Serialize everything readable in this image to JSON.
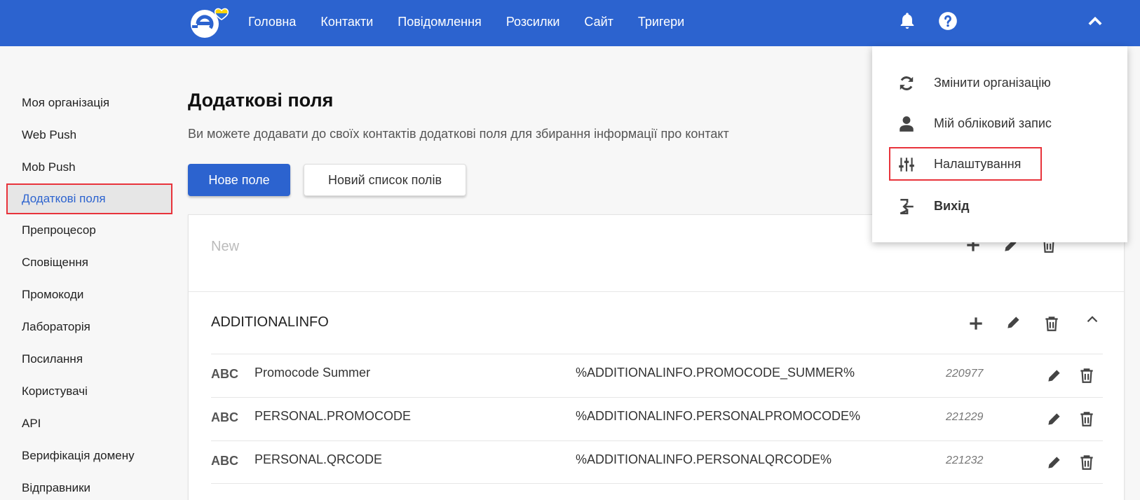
{
  "nav": {
    "items": [
      "Головна",
      "Контакти",
      "Повідомлення",
      "Розсилки",
      "Сайт",
      "Тригери"
    ]
  },
  "sidebar": {
    "items": [
      "Моя організація",
      "Web Push",
      "Mob Push",
      "Додаткові поля",
      "Препроцесор",
      "Сповіщення",
      "Промокоди",
      "Лабораторія",
      "Посилання",
      "Користувачі",
      "API",
      "Верифікація домену",
      "Відправники"
    ],
    "active_index": 3
  },
  "main": {
    "title": "Додаткові поля",
    "subtitle": "Ви можете додавати до своїх контактів додаткові поля для збирання інформації про контакт",
    "new_field_button": "Нове поле",
    "new_list_button": "Новий список полів"
  },
  "groups": [
    {
      "name": "New"
    },
    {
      "name": "ADDITIONALINFO",
      "fields": [
        {
          "type": "ABC",
          "name": "Promocode Summer",
          "variable": "%ADDITIONALINFO.PROMOCODE_SUMMER%",
          "id": "220977"
        },
        {
          "type": "ABC",
          "name": "PERSONAL.PROMOCODE",
          "variable": "%ADDITIONALINFO.PERSONALPROMOCODE%",
          "id": "221229"
        },
        {
          "type": "ABC",
          "name": "PERSONAL.QRCODE",
          "variable": "%ADDITIONALINFO.PERSONALQRCODE%",
          "id": "221232"
        }
      ]
    }
  ],
  "dropdown": {
    "items": [
      {
        "label": "Змінити організацію",
        "icon": "sync-icon"
      },
      {
        "label": "Мій обліковий запис",
        "icon": "user-icon"
      },
      {
        "label": "Налаштування",
        "icon": "sliders-icon"
      },
      {
        "label": "Вихід",
        "icon": "logout-icon"
      }
    ]
  },
  "colors": {
    "brand": "#2c63cf",
    "highlight": "#e8333b"
  }
}
